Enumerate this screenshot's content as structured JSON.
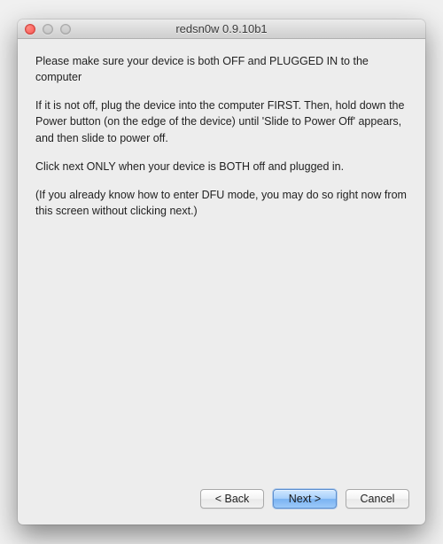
{
  "window": {
    "title": "redsn0w 0.9.10b1"
  },
  "content": {
    "p1": "Please make sure your device is both OFF and PLUGGED IN to the computer",
    "p2": "If it is not off, plug the device into the computer FIRST. Then, hold down the Power button (on the edge of the device) until 'Slide to Power Off' appears, and then slide to power off.",
    "p3": "Click next ONLY when your device is BOTH off and plugged in.",
    "p4": "(If you already know how to enter DFU mode, you may do so right now from this screen without clicking next.)"
  },
  "buttons": {
    "back": "< Back",
    "next": "Next >",
    "cancel": "Cancel"
  }
}
